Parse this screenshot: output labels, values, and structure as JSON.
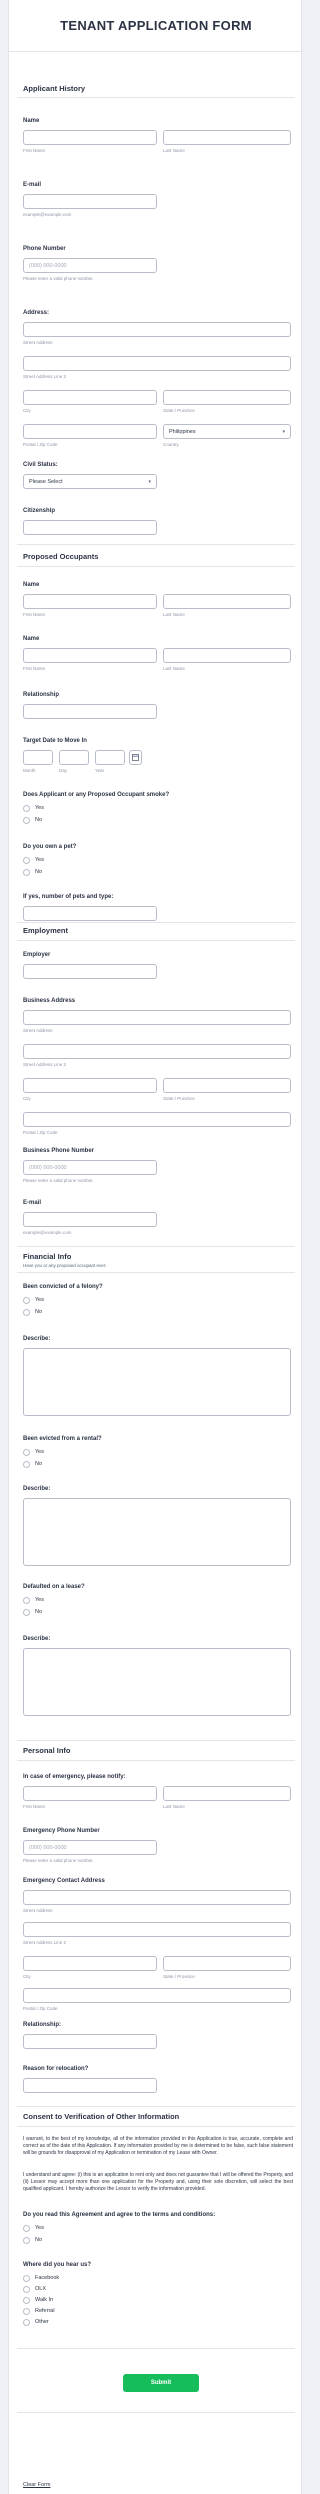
{
  "form": {
    "title": "TENANT APPLICATION FORM",
    "submit_label": "Submit",
    "clear_label": "Clear Form"
  },
  "common": {
    "first_name": "First Name",
    "last_name": "Last Name",
    "yes": "Yes",
    "no": "No",
    "street_address": "Street Address",
    "street_address_2": "Street Address Line 2",
    "city": "City",
    "state": "State / Province",
    "postal": "Postal / Zip Code",
    "country": "Country",
    "phone_placeholder": "(000) 000-0000",
    "phone_help": "Please enter a valid phone number.",
    "email_help": "example@example.com",
    "describe": "Describe:"
  },
  "applicant": {
    "section": "Applicant History",
    "name_label": "Name",
    "email_label": "E-mail",
    "phone_label": "Phone Number",
    "address_label": "Address:",
    "country_value": "Philippines",
    "civil_label": "Civil Status:",
    "civil_value": "Please Select",
    "citizenship_label": "Citizenship"
  },
  "occupants": {
    "section": "Proposed Occupants",
    "name1_label": "Name",
    "name2_label": "Name",
    "relationship_label": "Relationship",
    "move_label": "Target Date to Move In",
    "month": "Month",
    "day": "Day",
    "year": "Year",
    "smoke_label": "Does Applicant or any Proposed Occupant smoke?",
    "pet_label": "Do you own a pet?",
    "pets_number_label": "If yes, number of pets and type:"
  },
  "employment": {
    "section": "Employment",
    "employer_label": "Employer",
    "business_address_label": "Business Address",
    "business_phone_label": "Business Phone Number",
    "email_label": "E-mail"
  },
  "financial": {
    "section": "Financial Info",
    "subtitle": "Have you or any proposed occupant ever:",
    "felony_label": "Been convicted of a felony?",
    "evicted_label": "Been evicted from a rental?",
    "defaulted_label": "Defaulted on a lease?"
  },
  "personal": {
    "section": "Personal Info",
    "emergency_label": "In case of emergency, please notify:",
    "emergency_phone_label": "Emergency Phone Number",
    "emergency_address_label": "Emergency Contact Address",
    "relationship_label": "Relationship:",
    "relocation_label": "Reason for relocation?"
  },
  "consent": {
    "section": "Consent to Verification of Other Information",
    "para1": "I warrant, to the best of my knowledge, all of the information provided in this Application is true, accurate, complete and correct as of the date of this Application. If any information provided by me is determined to be false, such false statement will be grounds for disapproval of my Application or termination of my Lease with Owner.",
    "para2": "I understand and agree: (i) this is an application to rent only and does not guarantee that I will be offered the Property, and (ii) Lessor may accept more than one application for the Property and, using their sole discretion, will select the best qualified applicant. I hereby authorize the Lessor to verify the information provided.",
    "agree_label": "Do you read this Agreement and agree to the terms and conditions:",
    "hear_label": "Where did you hear us?",
    "hear_options": [
      "Facebook",
      "OLX",
      "Walk In",
      "Referral",
      "Other"
    ]
  }
}
